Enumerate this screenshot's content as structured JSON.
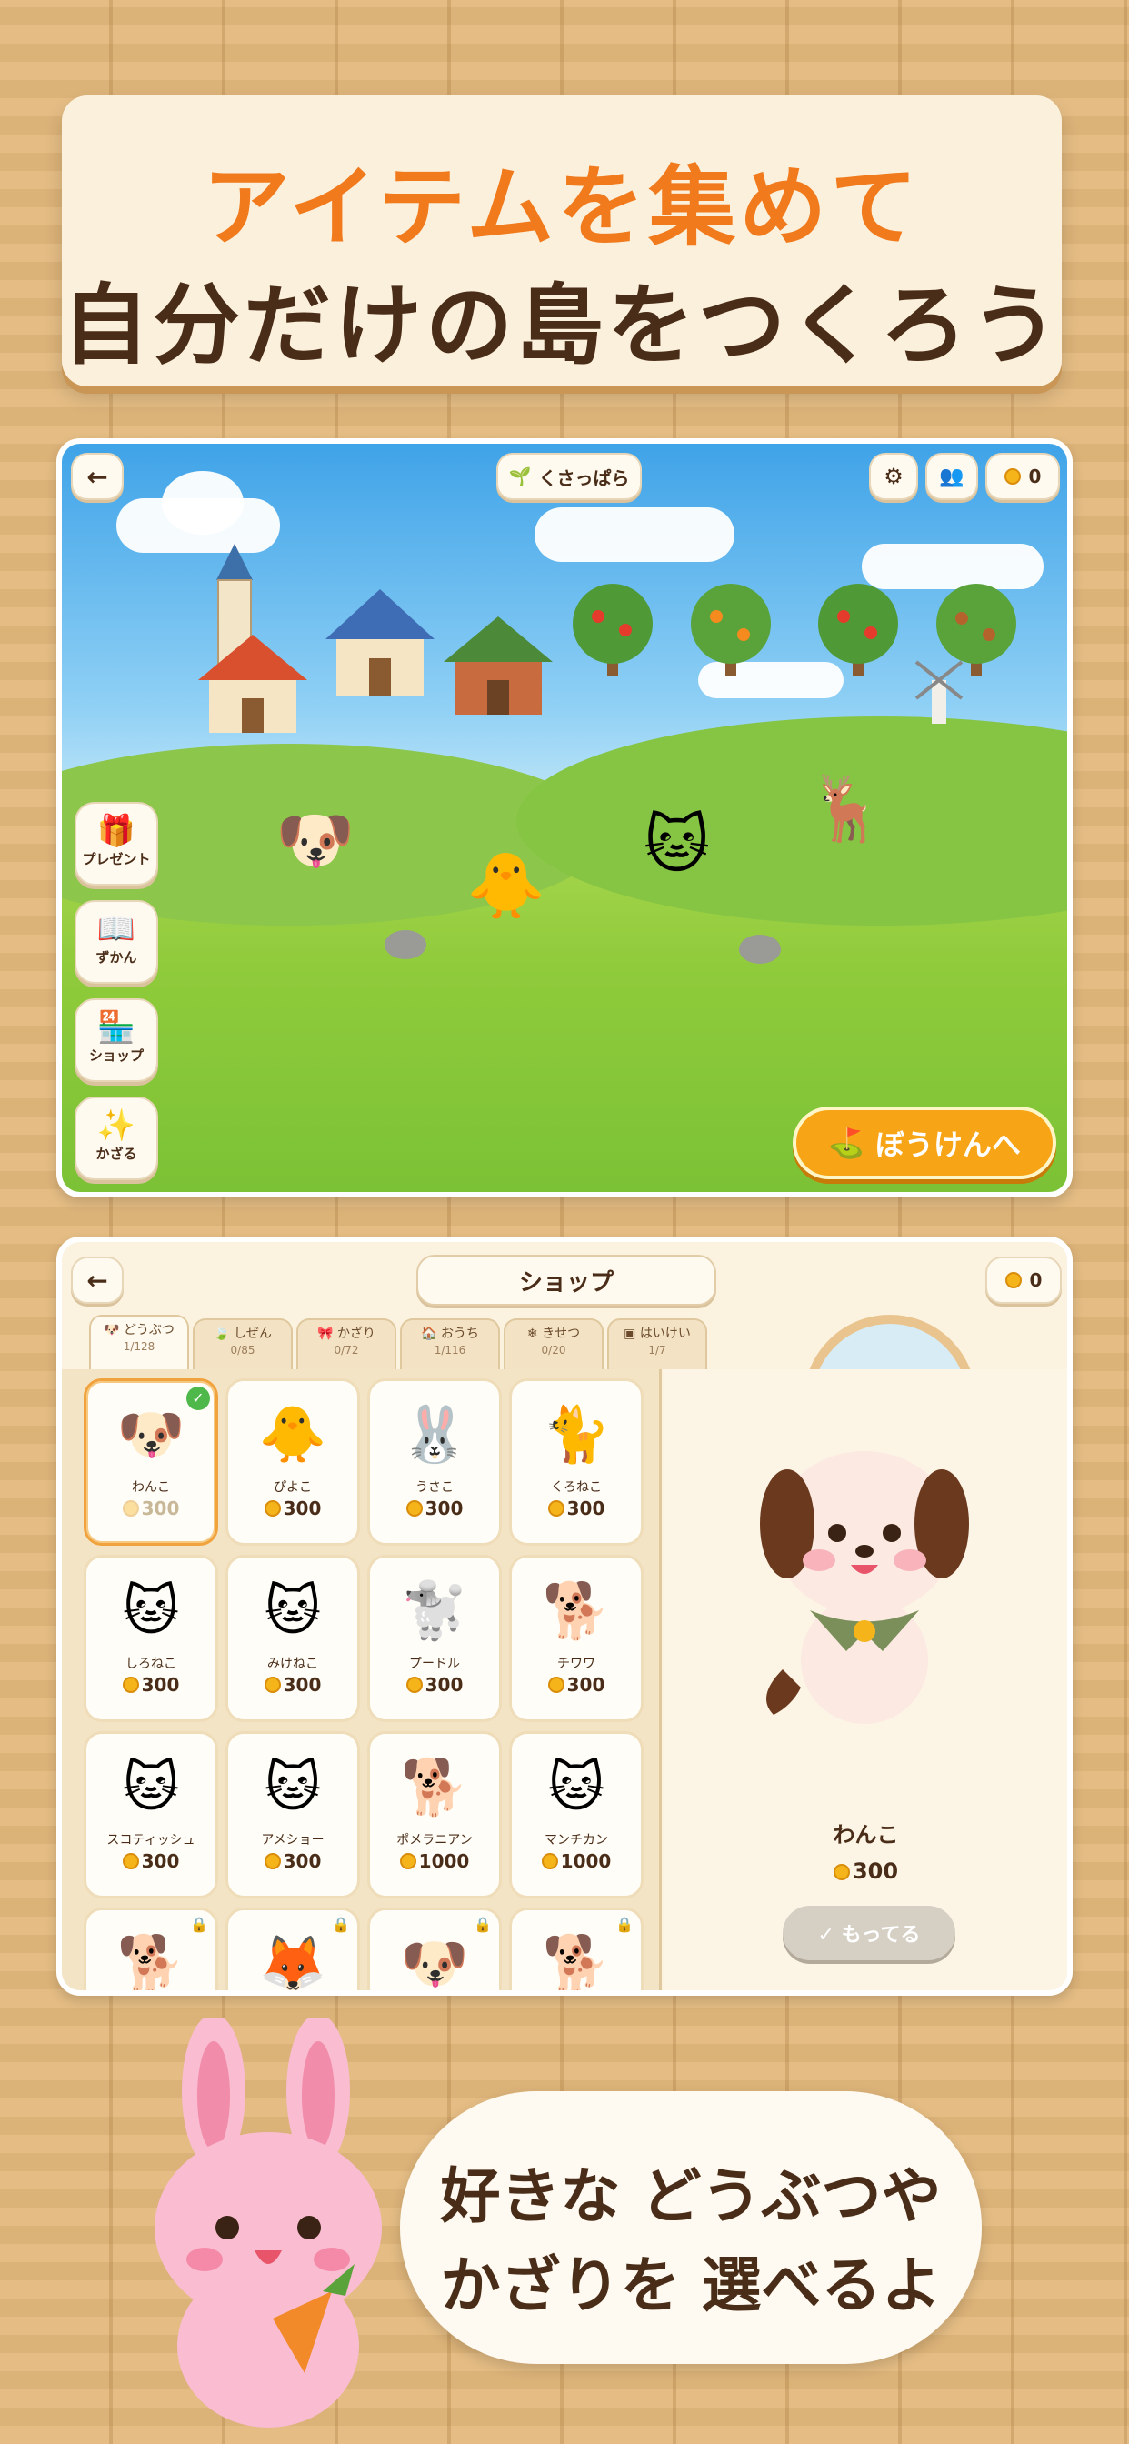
{
  "banner": {
    "line1": "アイテムを集めて",
    "line2": "自分だけの島をつくろう"
  },
  "scene": {
    "back_label": "←",
    "location_label": "くさっぱら",
    "coins": "0",
    "side_buttons": [
      "プレゼント",
      "ずかん",
      "ショップ",
      "かざる"
    ],
    "adventure_label": "ぼうけんへ"
  },
  "shop": {
    "back_label": "←",
    "title": "ショップ",
    "coins": "0",
    "tabs": [
      {
        "label": "どうぶつ",
        "count": "1/128"
      },
      {
        "label": "しぜん",
        "count": "0/85"
      },
      {
        "label": "かざり",
        "count": "0/72"
      },
      {
        "label": "おうち",
        "count": "1/116"
      },
      {
        "label": "きせつ",
        "count": "0/20"
      },
      {
        "label": "はいけい",
        "count": "1/7"
      }
    ],
    "items": [
      {
        "name": "わんこ",
        "price": "300"
      },
      {
        "name": "ぴよこ",
        "price": "300"
      },
      {
        "name": "うさこ",
        "price": "300"
      },
      {
        "name": "くろねこ",
        "price": "300"
      },
      {
        "name": "しろねこ",
        "price": "300"
      },
      {
        "name": "みけねこ",
        "price": "300"
      },
      {
        "name": "プードル",
        "price": "300"
      },
      {
        "name": "チワワ",
        "price": "300"
      },
      {
        "name": "スコティッシュ",
        "price": "300"
      },
      {
        "name": "アメショー",
        "price": "300"
      },
      {
        "name": "ポメラニアン",
        "price": "1000"
      },
      {
        "name": "マンチカン",
        "price": "1000"
      }
    ],
    "detail": {
      "name": "わんこ",
      "price": "300",
      "owned_label": "✓ もってる"
    }
  },
  "bubble": {
    "line1": "好きな どうぶつや",
    "line2": "かざりを 選べるよ"
  },
  "colors": {
    "accent_orange": "#f07a1c",
    "brown_text": "#4a2d18",
    "coin": "#f4b41a"
  }
}
